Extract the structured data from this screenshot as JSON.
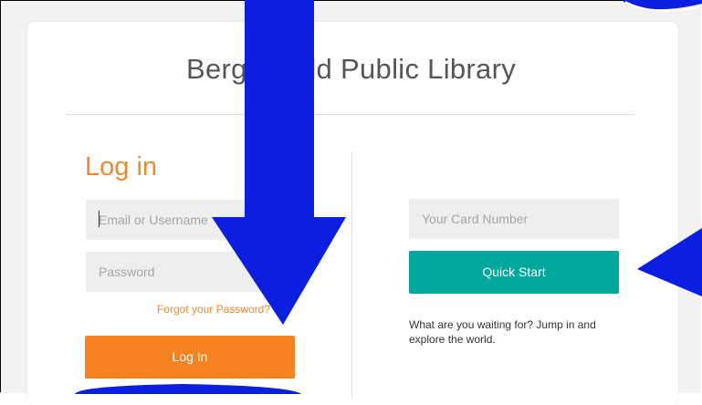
{
  "library": {
    "title": "Bergenfield Public Library"
  },
  "login": {
    "heading": "Log in",
    "email_placeholder": "Email or Username",
    "password_placeholder": "Password",
    "forgot_label": "Forgot your Password?",
    "button_label": "Log In"
  },
  "quick": {
    "card_placeholder": "Your Card Number",
    "button_label": "Quick Start",
    "tagline": "What are you waiting for? Jump in and explore the world."
  },
  "colors": {
    "accent_orange": "#f58220",
    "accent_teal": "#00a79d",
    "annotation_blue": "#0a1fe0"
  },
  "annotations": {
    "arrow_down_icon": "arrow-down-icon",
    "arrow_left_icon": "arrow-left-icon"
  }
}
